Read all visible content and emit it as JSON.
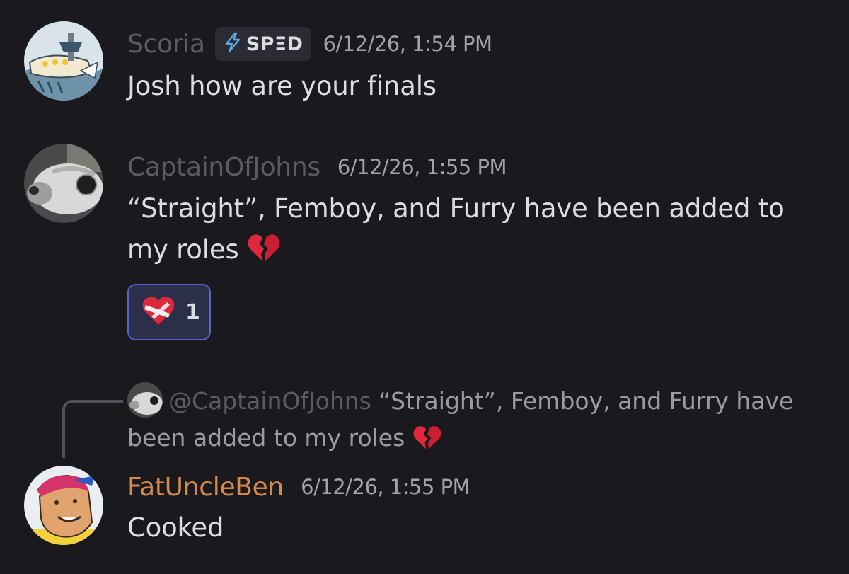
{
  "messages": [
    {
      "username": "Scoria",
      "tag": {
        "icon": "lightning-bolt-icon",
        "label": "SPΞD"
      },
      "timestamp": "6/12/26, 1:54 PM",
      "text": "Josh how are your finals"
    },
    {
      "username": "CaptainOfJohns",
      "timestamp": "6/12/26, 1:55 PM",
      "text_line1": "“Straight”, Femboy, and Furry have been added to",
      "text_line2": "my roles",
      "text_emoji": "broken-heart-icon",
      "reaction": {
        "emoji": "mending-heart-icon",
        "count": "1"
      }
    },
    {
      "reply_to": {
        "mention": "@CaptainOfJohns",
        "snippet": "“Straight”, Femboy, and Furry have been added to my roles",
        "emoji": "broken-heart-icon"
      },
      "username": "FatUncleBen",
      "timestamp": "6/12/26, 1:55 PM",
      "text": "Cooked"
    }
  ],
  "colors": {
    "background": "#1a1a1e",
    "reaction_border": "#5865c8",
    "reaction_bg": "#2c2f4a",
    "username_orange": "#d48a4a",
    "username_muted": "#5b5b62"
  }
}
